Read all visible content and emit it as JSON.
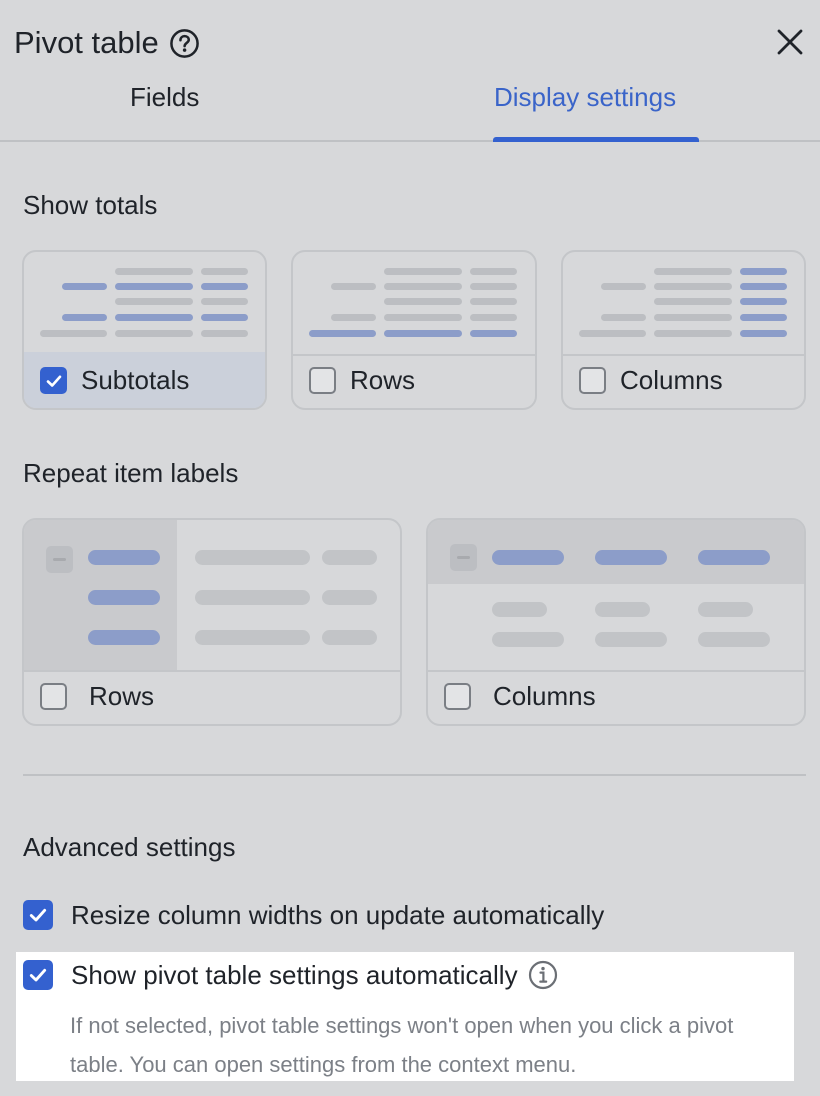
{
  "header": {
    "title": "Pivot table",
    "help_icon": "question-circle-icon",
    "close_icon": "close-icon"
  },
  "tabs": [
    {
      "label": "Fields",
      "active": false
    },
    {
      "label": "Display settings",
      "active": true
    }
  ],
  "show_totals": {
    "title": "Show totals",
    "options": [
      {
        "label": "Subtotals",
        "checked": true
      },
      {
        "label": "Rows",
        "checked": false
      },
      {
        "label": "Columns",
        "checked": false
      }
    ]
  },
  "repeat_labels": {
    "title": "Repeat item labels",
    "options": [
      {
        "label": "Rows",
        "checked": false
      },
      {
        "label": "Columns",
        "checked": false
      }
    ]
  },
  "advanced": {
    "title": "Advanced settings",
    "options": [
      {
        "label": "Resize column widths on update automatically",
        "checked": true
      },
      {
        "label": "Show pivot table settings automatically",
        "checked": true,
        "info_icon": "info-icon",
        "description": "If not selected, pivot table settings won't open when you click a pivot table. You can open settings from the context menu."
      }
    ]
  },
  "colors": {
    "accent": "#3461cf",
    "background": "#d7d8da",
    "highlight": "#ffffff"
  }
}
